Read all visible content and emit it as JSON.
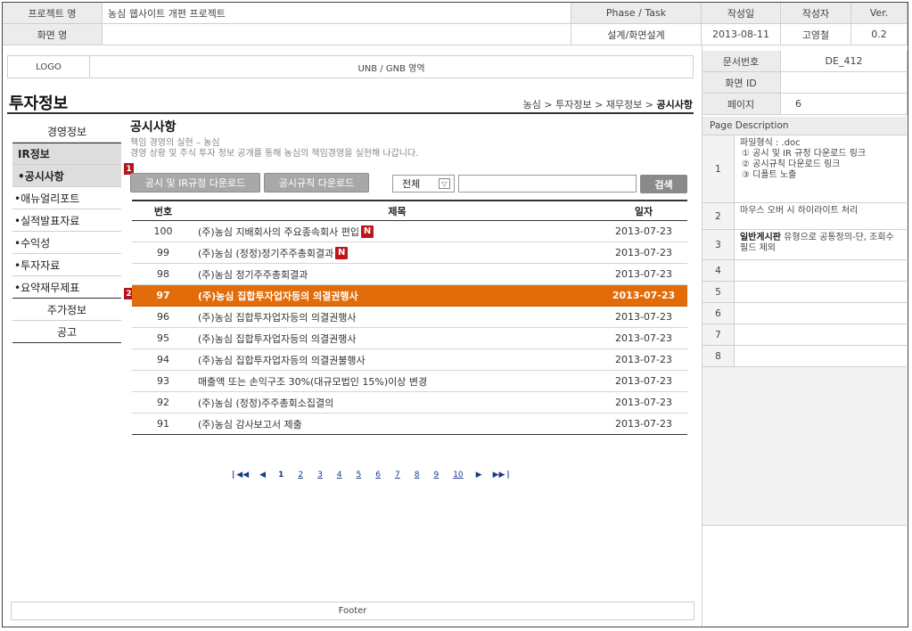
{
  "header": {
    "project_label": "프로젝트 명",
    "project_value": "농심 웹사이트 개편 프로젝트",
    "phase_label": "Phase / Task",
    "screen_label": "화면 명",
    "screen_value": "",
    "phase_value": "설계/화면설계",
    "author_date_label": "작성일",
    "author_label": "작성자",
    "ver_label": "Ver.",
    "date_value": "2013-08-11",
    "author_value": "고영철",
    "ver_value": "0.2",
    "doc_no_label": "문서번호",
    "doc_no_value": "DE_412",
    "screen_id_label": "화면 ID",
    "screen_id_value": "",
    "page_label": "페이지",
    "page_value": "6"
  },
  "unb": {
    "logo": "LOGO",
    "area": "UNB / GNB 영역"
  },
  "page": {
    "title": "투자정보",
    "breadcrumb_path": "농심 > 투자정보 > 재무정보 > ",
    "breadcrumb_current": "공시사항"
  },
  "lnb": {
    "items": [
      {
        "label": "경영정보"
      },
      {
        "label": "IR정보"
      },
      {
        "label": "•공시사항"
      },
      {
        "label": "•애뉴얼리포트"
      },
      {
        "label": "•실적발표자료"
      },
      {
        "label": "•수익성"
      },
      {
        "label": "•투자자료"
      },
      {
        "label": "•요약재무제표"
      },
      {
        "label": "주가정보"
      },
      {
        "label": "공고"
      }
    ]
  },
  "content": {
    "title": "공시사항",
    "subtitle": "책임 경영의 실현 – 농심",
    "description": "경영 상황 및 주식 투자 정보 공개를 통해 농심의 책임경영을 실현해 나갑니다.",
    "marker1": "1",
    "marker2": "2",
    "btn_download_ir": "공시 및 IR규정 다운로드",
    "btn_download_rule": "공시규칙 다운로드",
    "select_value": "전체",
    "select_arrow": "▽",
    "search_placeholder": "",
    "search_btn": "검색",
    "new_badge": "N"
  },
  "table": {
    "headers": {
      "no": "번호",
      "title": "제목",
      "date": "일자"
    },
    "rows": [
      {
        "no": "100",
        "title": "(주)농심 지배회사의 주요종속회사 편입",
        "date": "2013-07-23",
        "new": true
      },
      {
        "no": "99",
        "title": "(주)농심 (정정)정기주주총회결과",
        "date": "2013-07-23",
        "new": true
      },
      {
        "no": "98",
        "title": "(주)농심 정기주주총회결과",
        "date": "2013-07-23",
        "new": false
      },
      {
        "no": "97",
        "title": "(주)농심 집합투자업자등의 의결권행사",
        "date": "2013-07-23",
        "new": false
      },
      {
        "no": "96",
        "title": "(주)농심 집합투자업자등의 의결권행사",
        "date": "2013-07-23",
        "new": false
      },
      {
        "no": "95",
        "title": "(주)농심 집합투자업자등의 의결권행사",
        "date": "2013-07-23",
        "new": false
      },
      {
        "no": "94",
        "title": "(주)농심 집합투자업자등의 의결권불행사",
        "date": "2013-07-23",
        "new": false
      },
      {
        "no": "93",
        "title": "매출액 또는 손익구조 30%(대규모법인 15%)이상 변경",
        "date": "2013-07-23",
        "new": false
      },
      {
        "no": "92",
        "title": "(주)농심 (정정)주주총회소집결의",
        "date": "2013-07-23",
        "new": false
      },
      {
        "no": "91",
        "title": "(주)농심 감사보고서 제출",
        "date": "2013-07-23",
        "new": false
      }
    ]
  },
  "pager": {
    "first": "◀◀",
    "prev": "◀",
    "pages": [
      "1",
      "2",
      "3",
      "4",
      "5",
      "6",
      "7",
      "8",
      "9",
      "10"
    ],
    "next": "▶",
    "last": "▶▶",
    "bar_left": "|",
    "bar_right": "|"
  },
  "footer": "Footer",
  "description": {
    "header": "Page Description",
    "rows": [
      {
        "num": "1",
        "lines": [
          "파일형식 : .doc",
          "① 공시 및 IR 규정 다운로드 링크",
          "② 공시규칙 다운로드 링크",
          "③ 디폴트 노출"
        ]
      },
      {
        "num": "2",
        "lines": [
          "마우스 오버 시 하이라이트 처리"
        ]
      },
      {
        "num": "3",
        "bold": "일반게시판",
        "lines": [
          " 유형으로 공통정의-단, 조회수 필드 제외"
        ]
      },
      {
        "num": "4",
        "lines": []
      },
      {
        "num": "5",
        "lines": []
      },
      {
        "num": "6",
        "lines": []
      },
      {
        "num": "7",
        "lines": []
      },
      {
        "num": "8",
        "lines": []
      }
    ]
  },
  "colors": {
    "highlight": "#e36c0a",
    "badge": "#c0141b",
    "marker": "#b0161d"
  }
}
